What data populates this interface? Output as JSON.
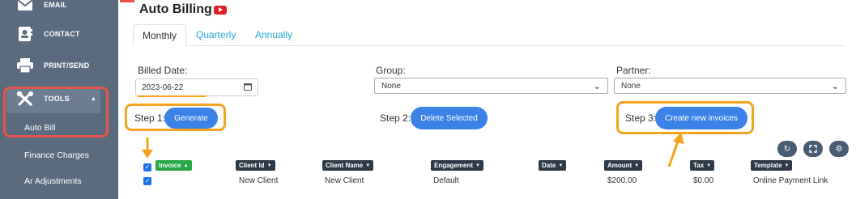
{
  "sidebar": {
    "items": [
      {
        "label": "EMAIL",
        "icon": "envelope-icon"
      },
      {
        "label": "CONTACT",
        "icon": "contact-card-icon"
      },
      {
        "label": "PRINT/SEND",
        "icon": "printer-icon"
      },
      {
        "label": "TOOLS",
        "icon": "tools-icon"
      }
    ],
    "sub_items": [
      "Auto Bill",
      "Finance Charges",
      "Ar Adjustments"
    ]
  },
  "page": {
    "title": "Auto Billing"
  },
  "tabs": [
    "Monthly",
    "Quarterly",
    "Annually"
  ],
  "active_tab": "Monthly",
  "filters": {
    "billed_date_label": "Billed Date:",
    "billed_date_value": "2023-06-22",
    "group_label": "Group:",
    "group_value": "None",
    "partner_label": "Partner:",
    "partner_value": "None"
  },
  "steps": {
    "step1_label": "Step 1:",
    "step1_button": "Generate",
    "step2_label": "Step 2:",
    "step2_button": "Delete Selected",
    "step3_label": "Step 3:",
    "step3_button": "Create new invoices"
  },
  "table": {
    "columns": [
      "Invoice",
      "Client Id",
      "Client Name",
      "Engagement",
      "Date",
      "Amount",
      "Tax",
      "Template"
    ],
    "rows": [
      {
        "checked": true,
        "client_id": "New Client",
        "client_name": "New Client",
        "engagement": "Default",
        "date": "",
        "amount": "$200.00",
        "tax": "$0.00",
        "template": "Online Payment Link"
      }
    ]
  },
  "colors": {
    "sidebar": "#5a6b80",
    "accent": "#3b82e8",
    "highlight_orange": "#f4a320",
    "highlight_red": "#e8534a",
    "link": "#20a8d8"
  }
}
